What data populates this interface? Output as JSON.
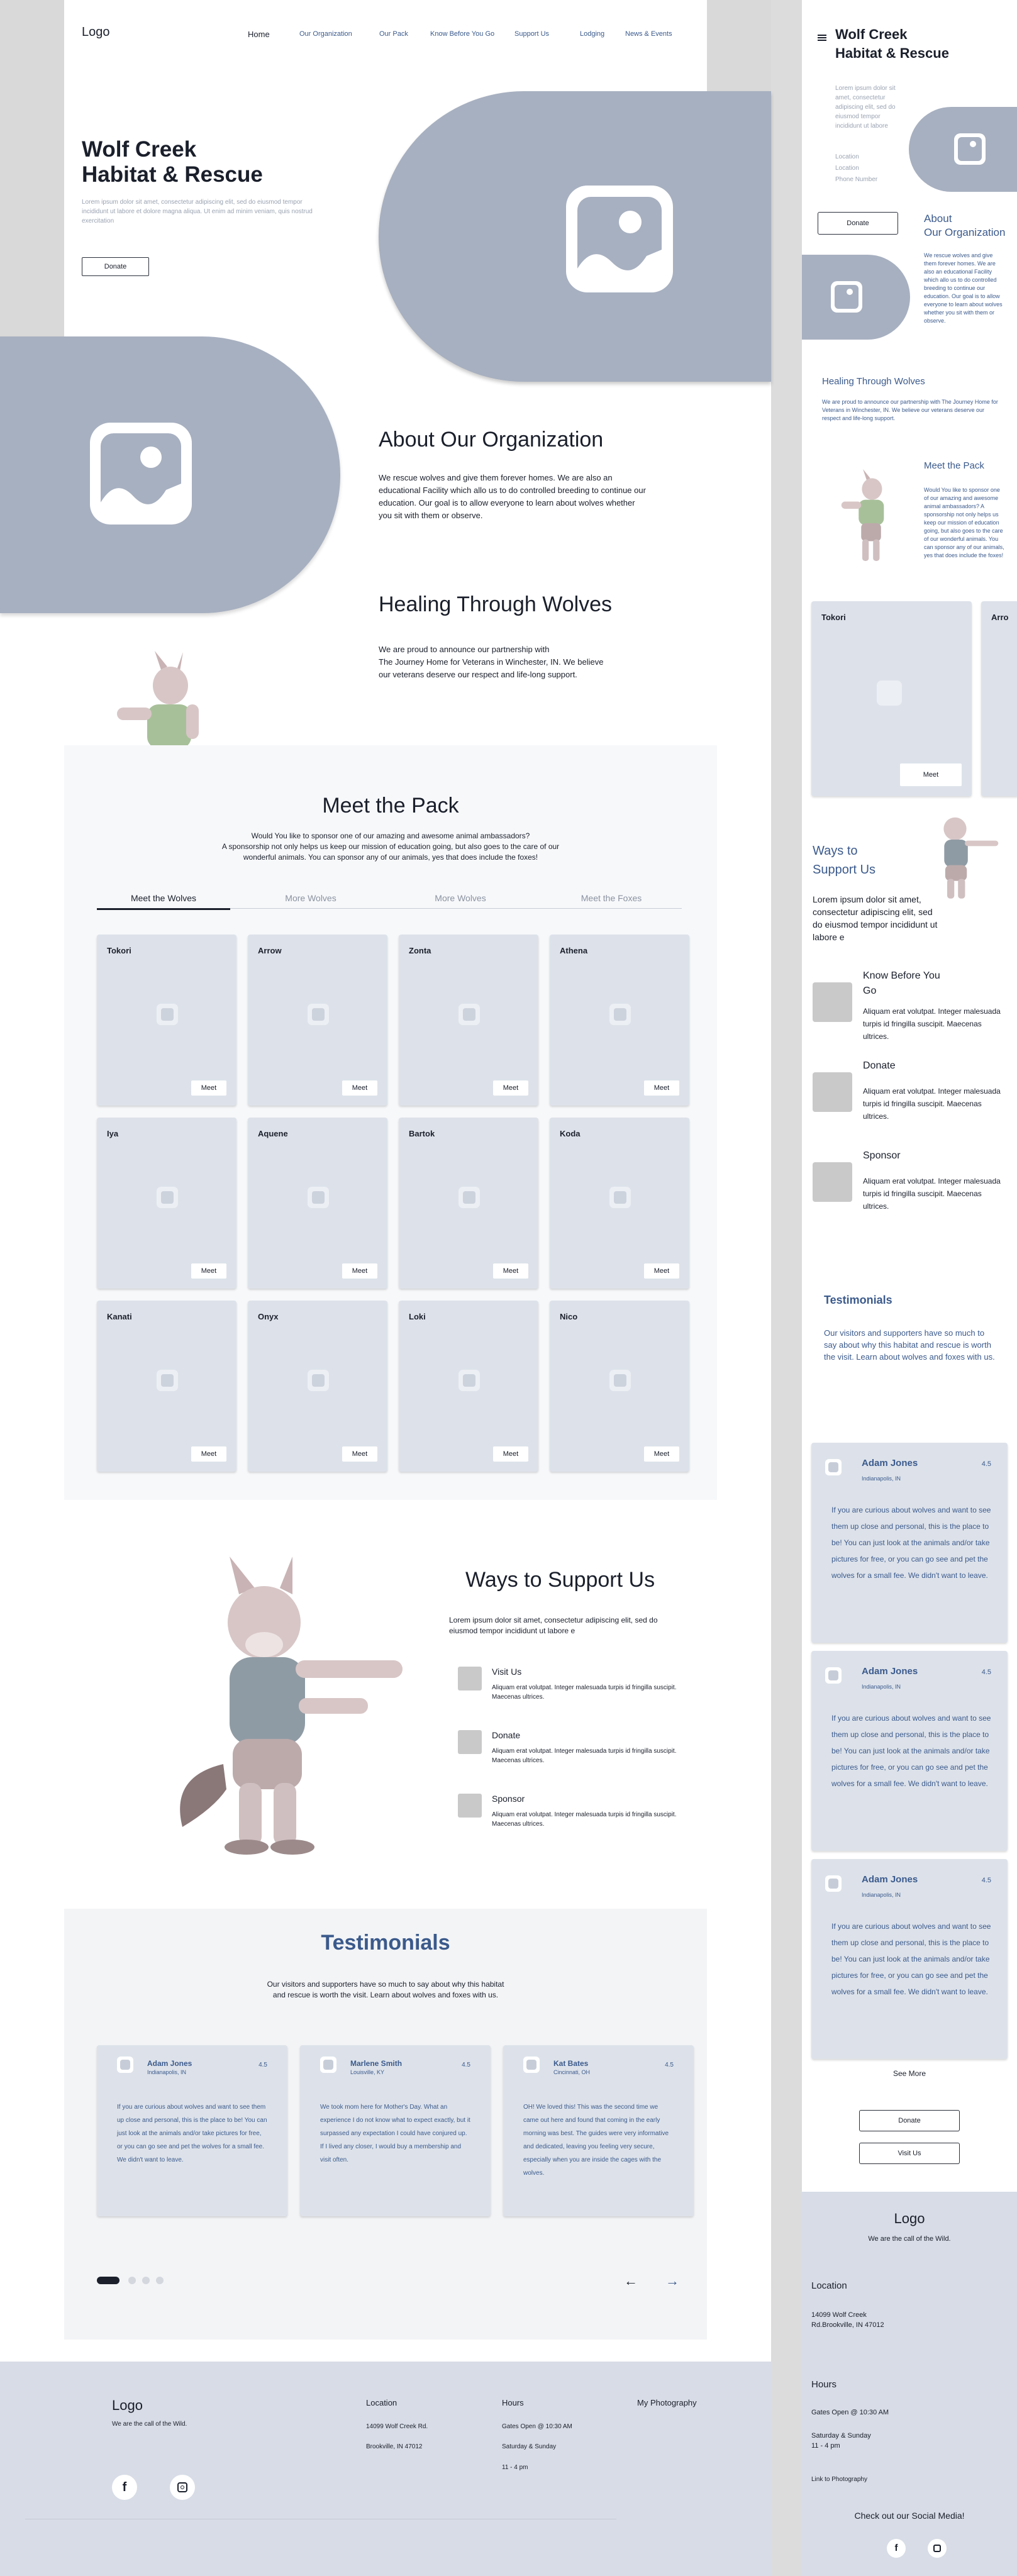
{
  "nav": {
    "logo": "Logo",
    "items": [
      "Home",
      "Our Organization",
      "Our Pack",
      "Know Before You Go",
      "Support Us",
      "Lodging",
      "News & Events"
    ]
  },
  "hero": {
    "title_line1": "Wolf Creek",
    "title_line2": "Habitat & Rescue",
    "lorem": "Lorem ipsum dolor sit amet, consectetur adipiscing elit, sed do eiusmod tempor incididunt ut labore et dolore magna aliqua. Ut enim ad minim veniam, quis nostrud exercitation",
    "donate": "Donate"
  },
  "about": {
    "title": "About Our Organization",
    "body": "We rescue wolves and give them forever homes. We are also an educational Facility which allo us to do controlled breeding to continue our education. Our goal is to allow everyone to learn about wolves whether you sit with them or observe."
  },
  "healing": {
    "title": "Healing Through Wolves",
    "line1": "We are proud to announce our partnership with",
    "line2": "The Journey Home for Veterans in Winchester, IN. We believe",
    "line3": "our veterans deserve our respect and life-long support."
  },
  "pack": {
    "title": "Meet the Pack",
    "intro1": "Would You like to sponsor one of our amazing and awesome animal ambassadors?",
    "intro2": "A sponsorship not only helps us keep our mission of education going, but also goes to the care of our",
    "intro3": "wonderful animals. You can sponsor any of our animals, yes that does include the foxes!",
    "tabs": [
      "Meet the Wolves",
      "More Wolves",
      "More Wolves",
      "Meet the Foxes"
    ],
    "meet": "Meet",
    "animals": [
      "Tokori",
      "Arrow",
      "Zonta",
      "Athena",
      "Iya",
      "Aquene",
      "Bartok",
      "Koda",
      "Kanati",
      "Onyx",
      "Loki",
      "Nico"
    ]
  },
  "support": {
    "title": "Ways to Support Us",
    "lorem": "Lorem ipsum dolor sit amet, consectetur adipiscing elit, sed do eiusmod tempor incididunt ut labore e",
    "items": [
      {
        "title": "Visit Us",
        "body": "Aliquam erat volutpat. Integer malesuada turpis id fringilla suscipit. Maecenas ultrices."
      },
      {
        "title": "Donate",
        "body": "Aliquam erat volutpat. Integer malesuada turpis id fringilla suscipit. Maecenas ultrices."
      },
      {
        "title": "Sponsor",
        "body": "Aliquam erat volutpat. Integer malesuada turpis id fringilla suscipit. Maecenas ultrices."
      }
    ]
  },
  "testimonials": {
    "title": "Testimonials",
    "intro1": "Our visitors and supporters have so much to say about why this habitat",
    "intro2": "and rescue is worth the visit. Learn about wolves and foxes with us.",
    "cards": [
      {
        "name": "Adam Jones",
        "loc": "Indianapolis, IN",
        "rating": "4.5",
        "text": "If you are curious about wolves and want to see them up close and personal, this is the place to be! You can just look at the animals and/or take pictures for free, or you can go see and pet the wolves for a small fee. We didn't want to leave."
      },
      {
        "name": "Marlene Smith",
        "loc": "Louisville, KY",
        "rating": "4.5",
        "text": "We took mom here for Mother's Day. What an experience I do not know what to expect exactly, but it surpassed any expectation I could have conjured up. If I lived any closer, I would buy a membership and visit often."
      },
      {
        "name": "Kat Bates",
        "loc": "Cincinnati, OH",
        "rating": "4.5",
        "text": "OH! We loved this! This was the second time we came out here and found that coming in the early morning was best. The guides were very informative and dedicated, leaving you feeling very secure, especially when you are inside the cages with the wolves."
      }
    ]
  },
  "footer": {
    "logo": "Logo",
    "tagline": "We are the call of the Wild.",
    "location_title": "Location",
    "address1": "14099 Wolf Creek Rd.",
    "address2": "Brookville, IN 47012",
    "hours_title": "Hours",
    "hours1": "Gates Open @ 10:30 AM",
    "hours2": "Saturday & Sunday",
    "hours3": "11 - 4 pm",
    "photo": "My Photography"
  },
  "mobile": {
    "title1": "Wolf Creek",
    "title2": "Habitat & Rescue",
    "lorem": "Lorem ipsum dolor sit amet, consectetur adipiscing elit, sed do eiusmod tempor incididunt ut labore",
    "loc1": "Location",
    "loc2": "Location",
    "phone": "Phone Number",
    "donate": "Donate",
    "about_title1": "About",
    "about_title2": "Our Organization",
    "about_body": "We rescue wolves and give them forever homes. We are also an educational Facility which allo us to do controlled breeding to continue our education. Our goal is to allow everyone to learn about wolves whether you sit with them or observe.",
    "healing_title": "Healing Through Wolves",
    "healing_body": "We are proud to announce our partnership with The Journey Home for Veterans in Winchester, IN. We believe our veterans deserve our respect and life-long support.",
    "pack_title": "Meet the Pack",
    "pack_body": "Would You like to sponsor one of our amazing and awesome animal ambassadors? A sponsorship not only helps us keep our mission of education going, but also goes to the care of our wonderful animals. You can sponsor any of our animals, yes that does include the foxes!",
    "card1": "Tokori",
    "card2": "Arro",
    "meet": "Meet",
    "support_title1": "Ways to",
    "support_title2": "Support Us",
    "support_lorem": "Lorem ipsum dolor sit amet, consectetur adipiscing elit, sed do eiusmod tempor incididunt ut labore e",
    "support_items": [
      {
        "title1": "Know Before You",
        "title2": "Go",
        "body": "Aliquam erat volutpat. Integer malesuada turpis id fringilla suscipit. Maecenas ultrices."
      },
      {
        "title1": "Donate",
        "title2": "",
        "body": "Aliquam erat volutpat. Integer malesuada turpis id fringilla suscipit. Maecenas ultrices."
      },
      {
        "title1": "Sponsor",
        "title2": "",
        "body": "Aliquam erat volutpat. Integer malesuada turpis id fringilla suscipit. Maecenas ultrices."
      }
    ],
    "testimonials_title": "Testimonials",
    "testimonials_body": "Our visitors and supporters have so much to say about why this habitat and rescue is worth the visit. Learn about wolves and foxes with us.",
    "tcard_name": "Adam Jones",
    "tcard_loc": "Indianapolis, IN",
    "tcard_rating": "4.5",
    "tcard_text": "If you are curious about wolves and want to see them up close and personal, this is the place to be! You can just look at the animals and/or take pictures for free, or you can go see and pet the wolves for a small fee. We didn't want to leave.",
    "see_more": "See More",
    "donate2": "Donate",
    "visit": "Visit Us",
    "footer_logo": "Logo",
    "footer_tag": "We are the call of the Wild.",
    "footer_loc_title": "Location",
    "footer_addr1": "14099 Wolf Creek",
    "footer_addr2": "Rd.Brookville, IN 47012",
    "footer_hours_title": "Hours",
    "footer_hours1": "Gates Open @ 10:30 AM",
    "footer_hours2": "Saturday & Sunday",
    "footer_hours3": "11 - 4 pm",
    "footer_photo": "Link to Photography",
    "footer_social": "Check out our Social Media!"
  },
  "colors": {
    "accent": "#3b5a8c",
    "placeholder": "#a7b0c0",
    "card": "#dde2ea",
    "footer": "#d7dce6"
  }
}
